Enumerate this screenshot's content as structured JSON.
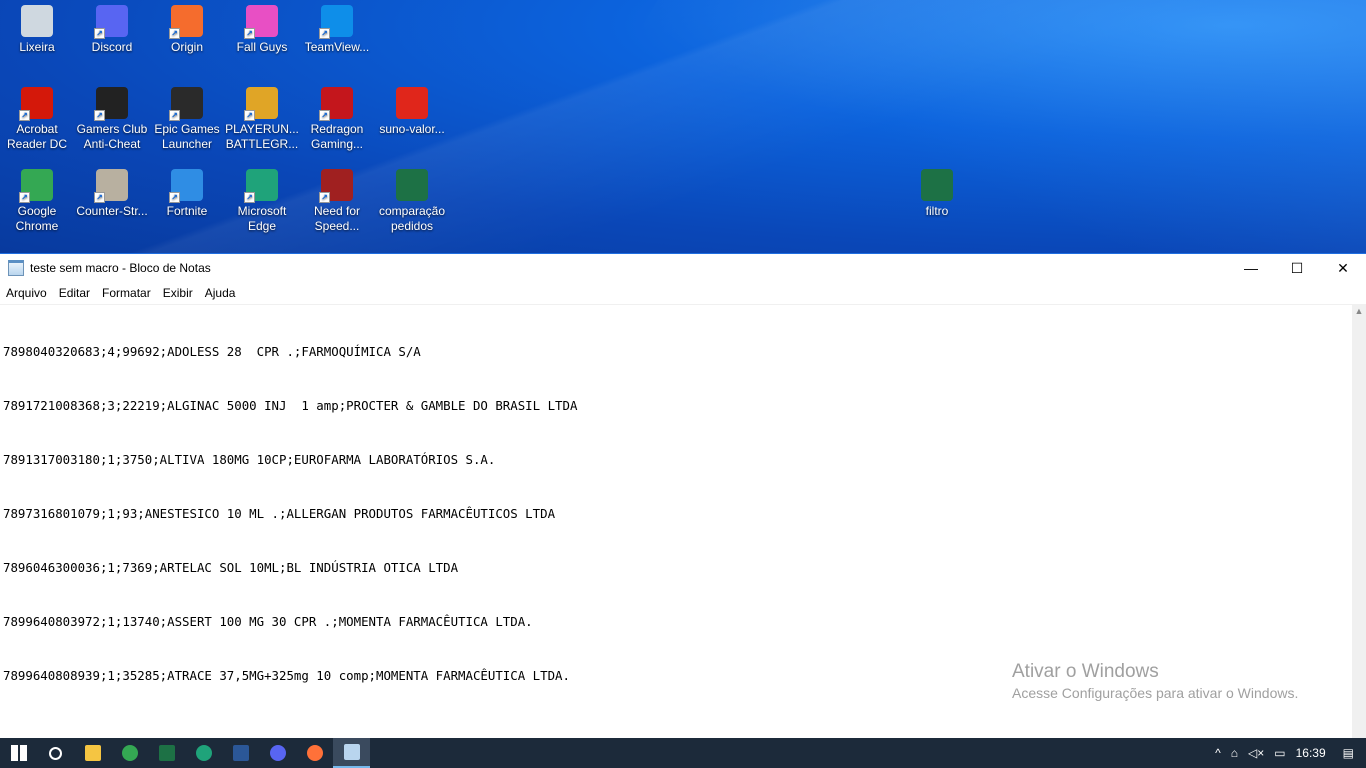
{
  "desktop": {
    "icons": [
      {
        "label": "Lixeira",
        "icon": "recycle-bin-icon",
        "color": "#cfd8e0"
      },
      {
        "label": "Discord",
        "icon": "discord-icon",
        "color": "#5865f2"
      },
      {
        "label": "Origin",
        "icon": "origin-icon",
        "color": "#f56c2d"
      },
      {
        "label": "Fall Guys",
        "icon": "fall-guys-icon",
        "color": "#e84fc4"
      },
      {
        "label": "TeamView...",
        "icon": "teamviewer-icon",
        "color": "#0e8ee9"
      },
      {
        "label": "Acrobat Reader DC",
        "icon": "acrobat-icon",
        "color": "#d4180a"
      },
      {
        "label": "Gamers Club Anti-Cheat",
        "icon": "gamers-club-icon",
        "color": "#222222"
      },
      {
        "label": "Epic Games Launcher",
        "icon": "epic-games-icon",
        "color": "#2a2a2a"
      },
      {
        "label": "PLAYERUN... BATTLEGR...",
        "icon": "pubg-icon",
        "color": "#e0a526"
      },
      {
        "label": "Redragon Gaming...",
        "icon": "redragon-icon",
        "color": "#c4161c"
      },
      {
        "label": "suno-valor...",
        "icon": "pdf-file-icon",
        "color": "#e0261b"
      },
      {
        "label": "Google Chrome",
        "icon": "chrome-icon",
        "color": "#34a853"
      },
      {
        "label": "Counter-Str...",
        "icon": "counter-strike-icon",
        "color": "#b8b0a0"
      },
      {
        "label": "Fortnite",
        "icon": "fortnite-icon",
        "color": "#2f8de4"
      },
      {
        "label": "Microsoft Edge",
        "icon": "edge-icon",
        "color": "#1fa37a"
      },
      {
        "label": "Need for Speed...",
        "icon": "need-for-speed-icon",
        "color": "#a02020"
      },
      {
        "label": "comparação pedidos",
        "icon": "excel-file-icon",
        "color": "#1d7145"
      },
      {
        "label": "filtro",
        "icon": "excel-file-icon",
        "color": "#1d7145"
      }
    ]
  },
  "window": {
    "title": "teste sem macro - Bloco de Notas",
    "menu": [
      "Arquivo",
      "Editar",
      "Formatar",
      "Exibir",
      "Ajuda"
    ],
    "minimize": "—",
    "maximize": "☐",
    "close": "✕",
    "lines": [
      "7898040320683;4;99692;ADOLESS 28  CPR .;FARMOQUÍMICA S/A",
      "7891721008368;3;22219;ALGINAC 5000 INJ  1 amp;PROCTER & GAMBLE DO BRASIL LTDA",
      "7891317003180;1;3750;ALTIVA 180MG 10CP;EUROFARMA LABORATÓRIOS S.A.",
      "7897316801079;1;93;ANESTESICO 10 ML .;ALLERGAN PRODUTOS FARMACÊUTICOS LTDA",
      "7896046300036;1;7369;ARTELAC SOL 10ML;BL INDÚSTRIA OTICA LTDA",
      "7899640803972;1;13740;ASSERT 100 MG 30 CPR .;MOMENTA FARMACÊUTICA LTDA.",
      "7899640808939;1;35285;ATRACE 37,5MG+325mg 10 comp;MOMENTA FARMACÊUTICA LTDA."
    ]
  },
  "watermark": {
    "title": "Ativar o Windows",
    "subtitle": "Acesse Configurações para ativar o Windows."
  },
  "taskbar": {
    "items": [
      {
        "icon": "start-windows-icon",
        "color": "#ffffff"
      },
      {
        "icon": "search-icon",
        "color": "#ffffff"
      },
      {
        "icon": "file-explorer-icon",
        "color": "#f5c542"
      },
      {
        "icon": "chrome-icon",
        "color": "#34a853"
      },
      {
        "icon": "excel-icon",
        "color": "#1d7145"
      },
      {
        "icon": "edge-icon",
        "color": "#1fa37a"
      },
      {
        "icon": "word-icon",
        "color": "#2b5797"
      },
      {
        "icon": "discord-icon",
        "color": "#5865f2"
      },
      {
        "icon": "firefox-icon",
        "color": "#ff7139"
      },
      {
        "icon": "notepad-icon",
        "color": "#b9d5ee"
      }
    ],
    "tray": {
      "chevron": "^",
      "time": "16:39",
      "notifications": "▤"
    }
  }
}
